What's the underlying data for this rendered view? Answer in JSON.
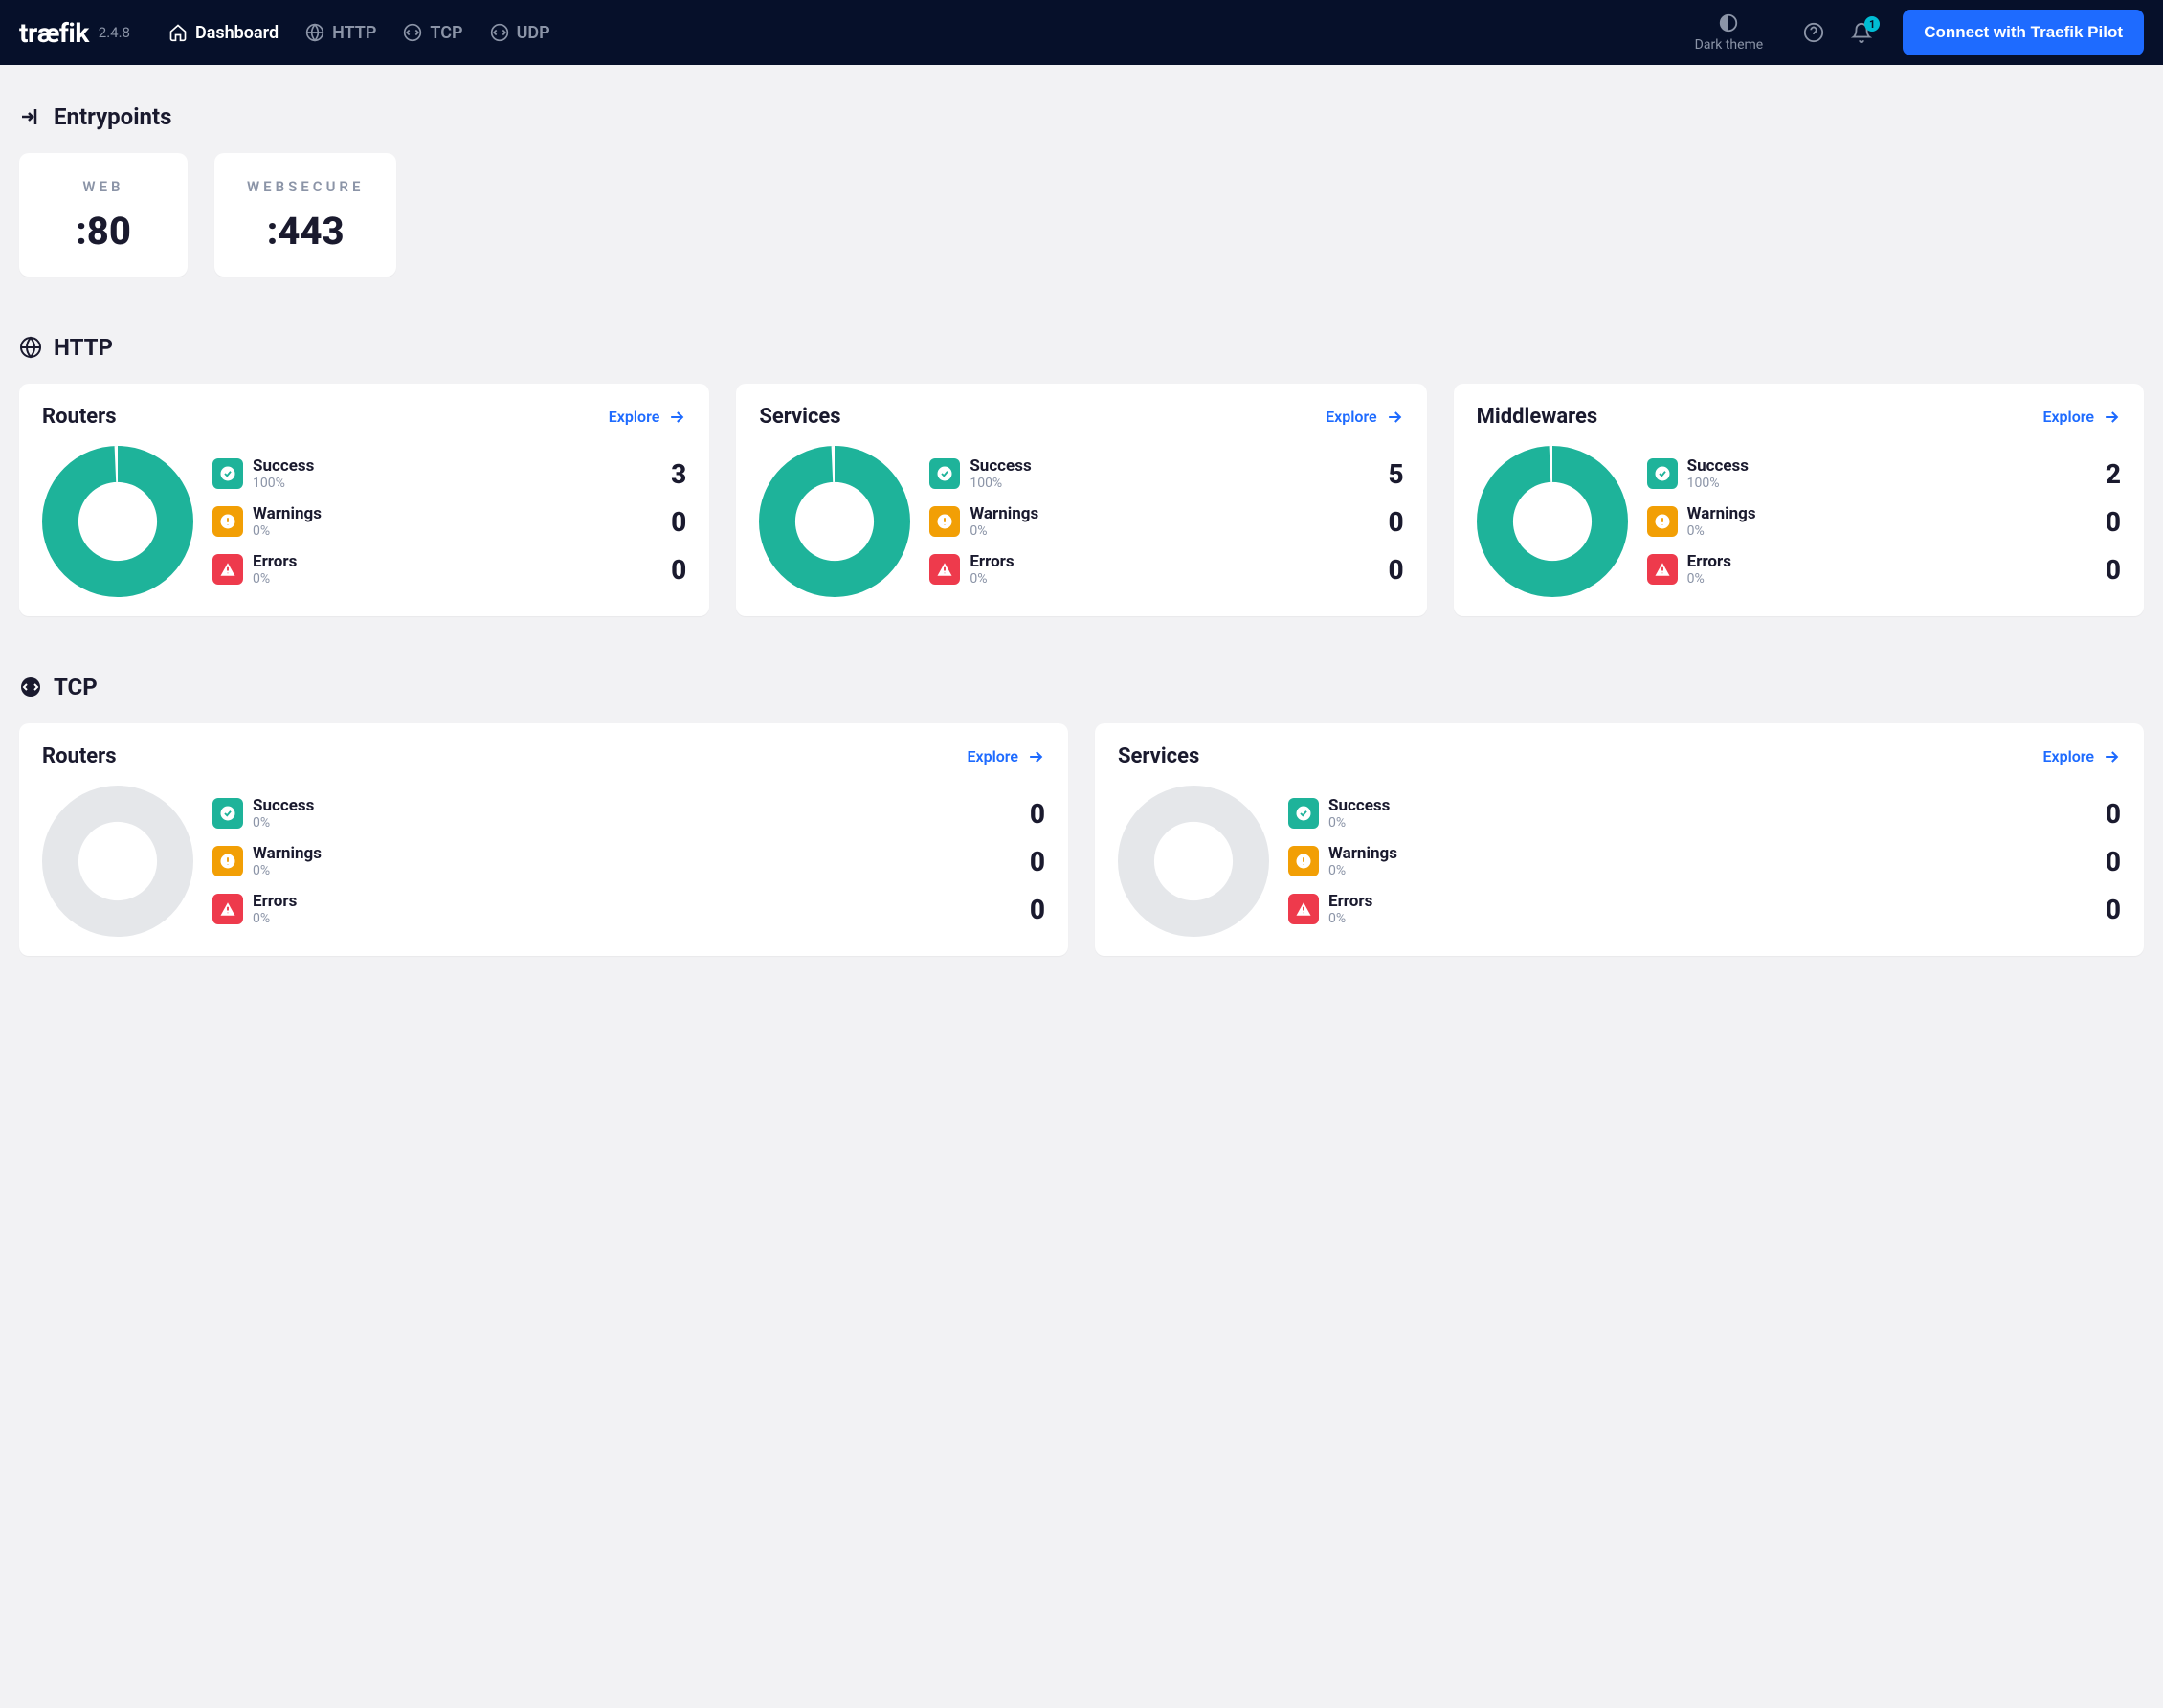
{
  "header": {
    "logo": "træfik",
    "version": "2.4.8",
    "nav": {
      "dashboard": "Dashboard",
      "http": "HTTP",
      "tcp": "TCP",
      "udp": "UDP"
    },
    "theme_label": "Dark theme",
    "notif_count": "1",
    "pilot_button": "Connect with Traefik Pilot"
  },
  "sections": {
    "entrypoints_title": "Entrypoints",
    "http_title": "HTTP",
    "tcp_title": "TCP"
  },
  "entrypoints": [
    {
      "name": "WEB",
      "port": ":80"
    },
    {
      "name": "WEBSECURE",
      "port": ":443"
    }
  ],
  "labels": {
    "explore": "Explore",
    "success": "Success",
    "warnings": "Warnings",
    "errors": "Errors"
  },
  "http": {
    "routers": {
      "title": "Routers",
      "success_pct": "100%",
      "success_count": "3",
      "warnings_pct": "0%",
      "warnings_count": "0",
      "errors_pct": "0%",
      "errors_count": "0"
    },
    "services": {
      "title": "Services",
      "success_pct": "100%",
      "success_count": "5",
      "warnings_pct": "0%",
      "warnings_count": "0",
      "errors_pct": "0%",
      "errors_count": "0"
    },
    "middlewares": {
      "title": "Middlewares",
      "success_pct": "100%",
      "success_count": "2",
      "warnings_pct": "0%",
      "warnings_count": "0",
      "errors_pct": "0%",
      "errors_count": "0"
    }
  },
  "tcp": {
    "routers": {
      "title": "Routers",
      "success_pct": "0%",
      "success_count": "0",
      "warnings_pct": "0%",
      "warnings_count": "0",
      "errors_pct": "0%",
      "errors_count": "0"
    },
    "services": {
      "title": "Services",
      "success_pct": "0%",
      "success_count": "0",
      "warnings_pct": "0%",
      "warnings_count": "0",
      "errors_pct": "0%",
      "errors_count": "0"
    }
  },
  "chart_data": [
    {
      "type": "pie",
      "title": "HTTP Routers",
      "categories": [
        "Success",
        "Warnings",
        "Errors"
      ],
      "values": [
        3,
        0,
        0
      ]
    },
    {
      "type": "pie",
      "title": "HTTP Services",
      "categories": [
        "Success",
        "Warnings",
        "Errors"
      ],
      "values": [
        5,
        0,
        0
      ]
    },
    {
      "type": "pie",
      "title": "HTTP Middlewares",
      "categories": [
        "Success",
        "Warnings",
        "Errors"
      ],
      "values": [
        2,
        0,
        0
      ]
    },
    {
      "type": "pie",
      "title": "TCP Routers",
      "categories": [
        "Success",
        "Warnings",
        "Errors"
      ],
      "values": [
        0,
        0,
        0
      ]
    },
    {
      "type": "pie",
      "title": "TCP Services",
      "categories": [
        "Success",
        "Warnings",
        "Errors"
      ],
      "values": [
        0,
        0,
        0
      ]
    }
  ],
  "colors": {
    "success": "#1eb39a",
    "warning": "#f29f05",
    "error": "#ee3a4c",
    "empty": "#e5e7ea",
    "accent": "#1e6bff"
  }
}
